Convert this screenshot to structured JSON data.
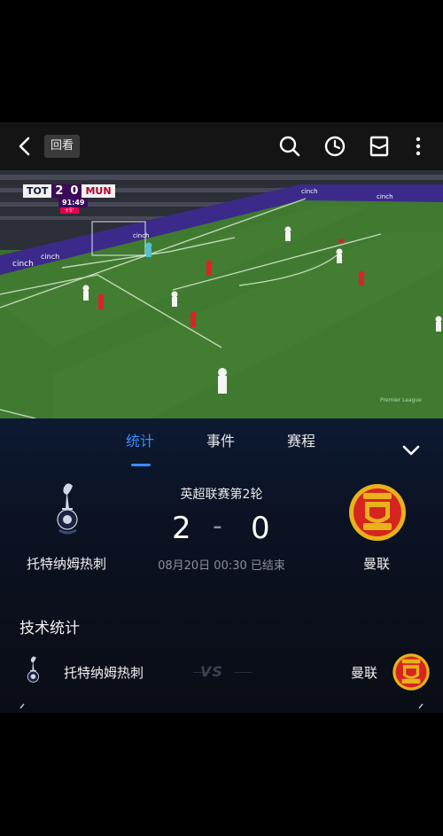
{
  "topbar": {
    "replay_label": "回看",
    "icons": [
      "back-icon",
      "search-icon",
      "clock-icon",
      "bookmark-icon",
      "more-icon"
    ]
  },
  "video": {
    "scorebug": {
      "home": "TOT",
      "home_score": "2",
      "away_score": "0",
      "away": "MUN",
      "clock": "91:49",
      "extra": "+5'"
    },
    "watermark": "Premier League"
  },
  "tabs": [
    {
      "label": "统计",
      "active": true
    },
    {
      "label": "事件",
      "active": false
    },
    {
      "label": "赛程",
      "active": false
    }
  ],
  "match": {
    "competition": "英超联赛第2轮",
    "home_name": "托特纳姆热刺",
    "away_name": "曼联",
    "home_score": "2",
    "away_score": "0",
    "dash": "-",
    "time_status": "08月20日 00:30 已结束"
  },
  "stats": {
    "section_title": "技术统计",
    "home_name": "托特纳姆热刺",
    "away_name": "曼联",
    "vs_label": "VS"
  },
  "colors": {
    "accent": "#3b8cff",
    "panel_bg": "#0b1222",
    "muted": "#8a8f99",
    "pitch": "#3a6f2e"
  }
}
